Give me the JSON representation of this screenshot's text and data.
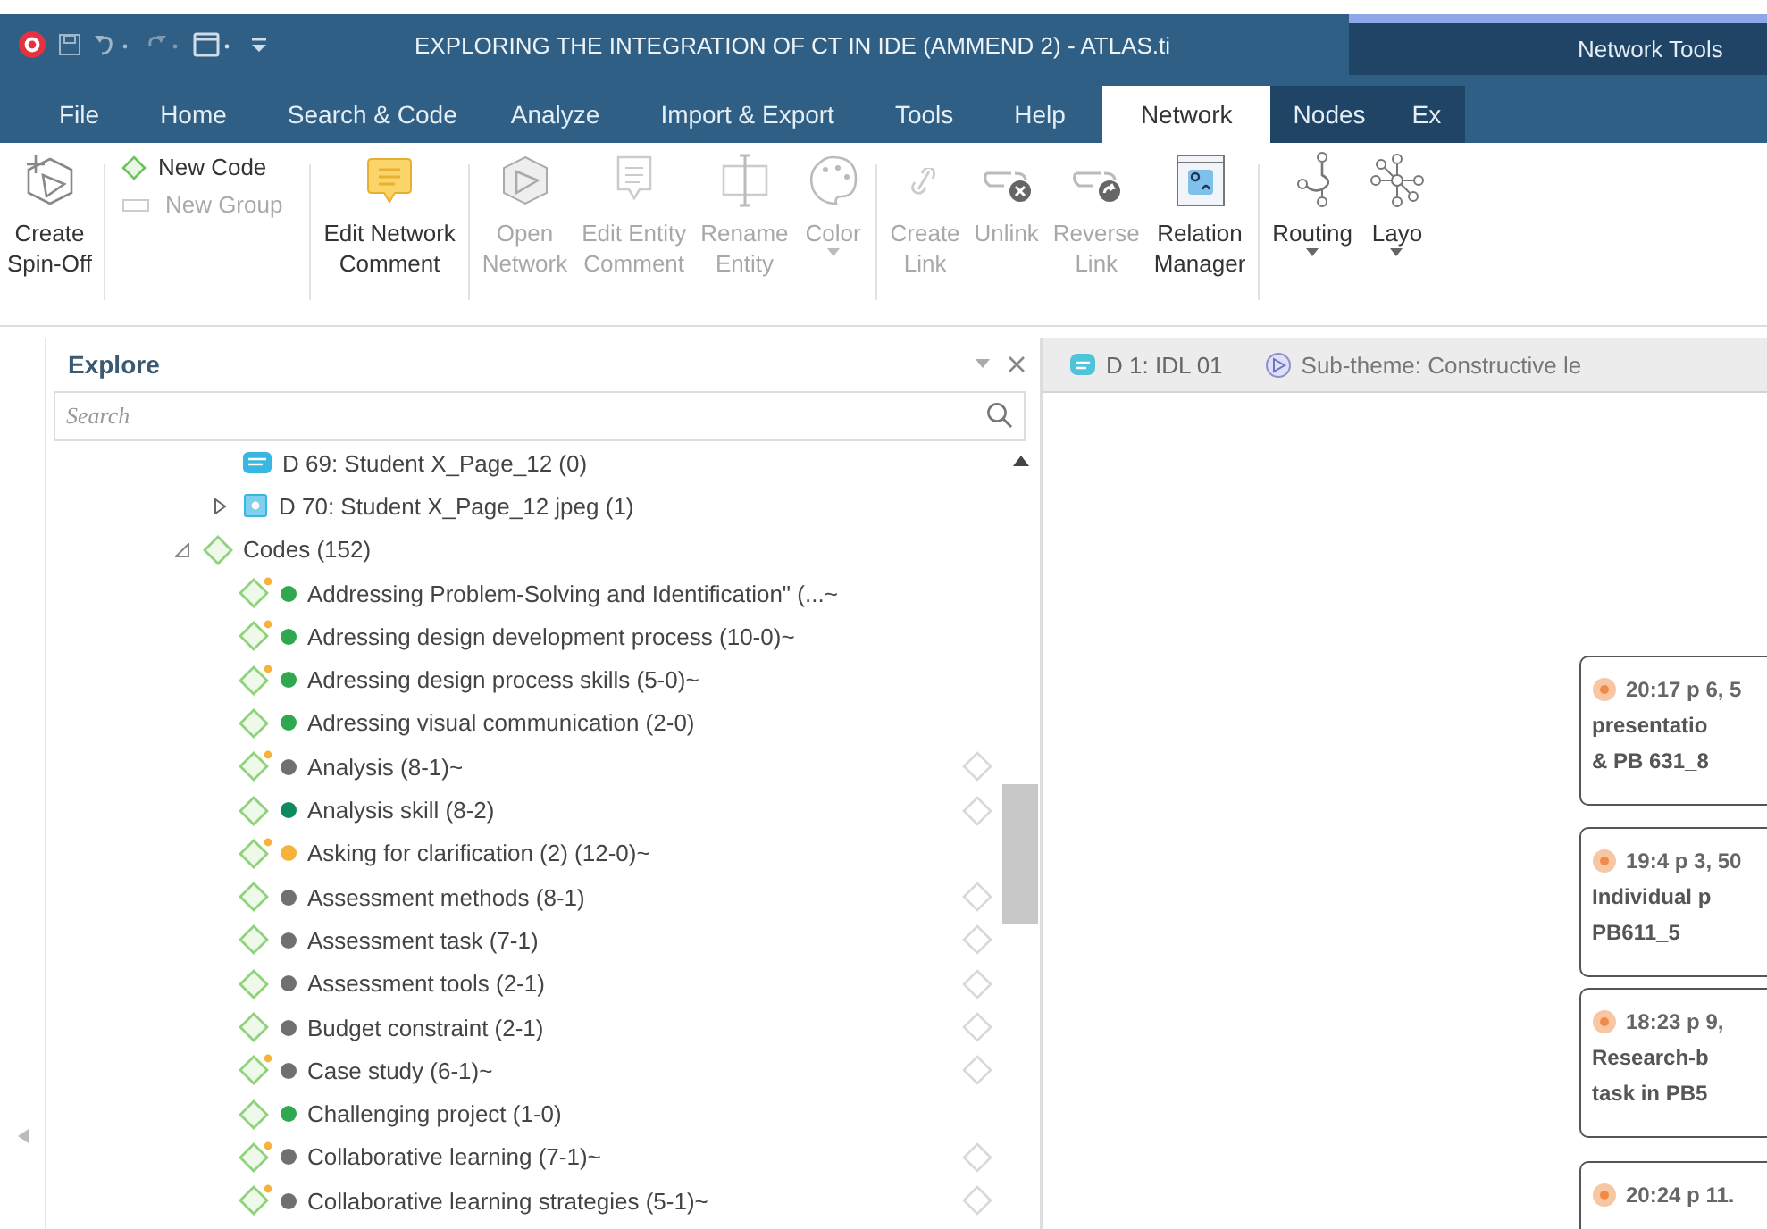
{
  "window": {
    "title": "EXPLORING THE INTEGRATION OF CT IN IDE (AMMEND 2) - ATLAS.ti",
    "context_group": "Network Tools"
  },
  "menu_tabs": [
    {
      "label": "File",
      "selected": false
    },
    {
      "label": "Home",
      "selected": false
    },
    {
      "label": "Search & Code",
      "selected": false
    },
    {
      "label": "Analyze",
      "selected": false
    },
    {
      "label": "Import & Export",
      "selected": false
    },
    {
      "label": "Tools",
      "selected": false
    },
    {
      "label": "Help",
      "selected": false
    },
    {
      "label": "Network",
      "selected": true
    },
    {
      "label": "Nodes",
      "selected": false
    },
    {
      "label": "Ex",
      "selected": false
    }
  ],
  "ribbon_groups": [
    {
      "buttons": [
        {
          "kind": "large",
          "label": "Create\nSpin-Off",
          "disabled": false,
          "dropdown": false
        }
      ]
    },
    {
      "buttons": [
        {
          "kind": "small",
          "label": "New Code",
          "disabled": false
        },
        {
          "kind": "small",
          "label": "New Group",
          "disabled": true
        }
      ]
    },
    {
      "buttons": [
        {
          "kind": "large",
          "label": "Edit Network\nComment",
          "disabled": false,
          "dropdown": false
        }
      ]
    },
    {
      "buttons": [
        {
          "kind": "large",
          "label": "Open\nNetwork",
          "disabled": true,
          "dropdown": false
        },
        {
          "kind": "large",
          "label": "Edit Entity\nComment",
          "disabled": true,
          "dropdown": false
        },
        {
          "kind": "large",
          "label": "Rename\nEntity",
          "disabled": true,
          "dropdown": false
        },
        {
          "kind": "large",
          "label": "Color",
          "disabled": true,
          "dropdown": true
        }
      ]
    },
    {
      "buttons": [
        {
          "kind": "large",
          "label": "Create\nLink",
          "disabled": true,
          "dropdown": false
        },
        {
          "kind": "large",
          "label": "Unlink",
          "disabled": true,
          "dropdown": false
        },
        {
          "kind": "large",
          "label": "Reverse\nLink",
          "disabled": true,
          "dropdown": false
        },
        {
          "kind": "large",
          "label": "Relation\nManager",
          "disabled": false,
          "dropdown": false
        }
      ]
    },
    {
      "buttons": [
        {
          "kind": "large",
          "label": "Routing",
          "disabled": false,
          "dropdown": true
        },
        {
          "kind": "large",
          "label": "Layo",
          "disabled": false,
          "dropdown": true
        }
      ]
    }
  ],
  "explore": {
    "title": "Explore",
    "search": {
      "placeholder": "Search"
    },
    "documents": [
      {
        "label": "D 69: Student X_Page_12 (0)",
        "kind": "text"
      },
      {
        "label": "D 70: Student X_Page_12 jpeg (1)",
        "kind": "image",
        "expanded": false
      }
    ],
    "codes": {
      "label": "Codes (152)",
      "expanded": true,
      "children": [
        {
          "label": "Addressing Problem-Solving and Identification\" (...~",
          "color": "#2fa84f",
          "commented": true,
          "in_network": false
        },
        {
          "label": "Adressing design development process (10-0)~",
          "color": "#2fa84f",
          "commented": true,
          "in_network": false
        },
        {
          "label": "Adressing design process skills (5-0)~",
          "color": "#2fa84f",
          "commented": true,
          "in_network": false
        },
        {
          "label": "Adressing visual communication (2-0)",
          "color": "#2fa84f",
          "commented": false,
          "in_network": false
        },
        {
          "label": "Analysis (8-1)~",
          "color": "#707070",
          "commented": true,
          "in_network": true
        },
        {
          "label": "Analysis skill (8-2)",
          "color": "#0e8a5c",
          "commented": false,
          "in_network": true
        },
        {
          "label": "Asking for clarification (2) (12-0)~",
          "color": "#f6b23a",
          "commented": true,
          "in_network": false
        },
        {
          "label": "Assessment methods (8-1)",
          "color": "#707070",
          "commented": false,
          "in_network": true
        },
        {
          "label": "Assessment task (7-1)",
          "color": "#707070",
          "commented": false,
          "in_network": true
        },
        {
          "label": "Assessment tools (2-1)",
          "color": "#707070",
          "commented": false,
          "in_network": true
        },
        {
          "label": "Budget constraint (2-1)",
          "color": "#707070",
          "commented": false,
          "in_network": true
        },
        {
          "label": "Case study (6-1)~",
          "color": "#707070",
          "commented": true,
          "in_network": true
        },
        {
          "label": "Challenging project (1-0)",
          "color": "#2fa84f",
          "commented": false,
          "in_network": false
        },
        {
          "label": "Collaborative learning (7-1)~",
          "color": "#707070",
          "commented": true,
          "in_network": true
        },
        {
          "label": "Collaborative learning strategies (5-1)~",
          "color": "#707070",
          "commented": true,
          "in_network": true
        }
      ]
    }
  },
  "editor_tabs": [
    {
      "label": "D 1: IDL 01",
      "kind": "document",
      "selected": false
    },
    {
      "label": "Sub-theme: Constructive le",
      "kind": "network",
      "selected": true
    }
  ],
  "network_nodes": [
    {
      "lines": [
        "20:17 p 6, 5",
        "presentatio",
        "& PB 631_8"
      ]
    },
    {
      "lines": [
        "19:4 p 3, 50",
        "Individual p",
        "PB611_5"
      ]
    },
    {
      "lines": [
        "18:23 p 9,",
        "Research-b",
        "task in PB5"
      ]
    },
    {
      "lines": [
        "20:24 p 11."
      ]
    }
  ]
}
